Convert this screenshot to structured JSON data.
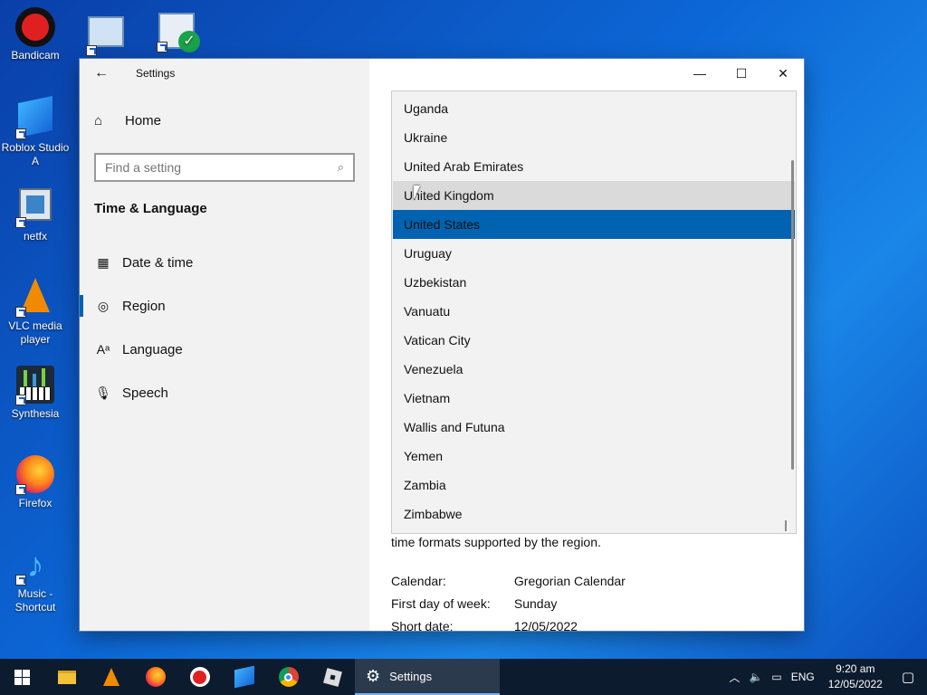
{
  "desktop": {
    "icons": [
      {
        "label": "Bandicam"
      },
      {
        "label": "Roblox Studio A"
      },
      {
        "label": "netfx"
      },
      {
        "label": "VLC media player"
      },
      {
        "label": "Synthesia"
      },
      {
        "label": "Firefox"
      },
      {
        "label": "Music - Shortcut"
      }
    ]
  },
  "window": {
    "title": "Settings",
    "controls": {
      "minimize": "—",
      "maximize": "☐",
      "close": "✕"
    }
  },
  "sidebar": {
    "home_label": "Home",
    "search_placeholder": "Find a setting",
    "section_title": "Time & Language",
    "items": [
      {
        "label": "Date & time",
        "icon": "calendar-clock-icon"
      },
      {
        "label": "Region",
        "icon": "globe-icon"
      },
      {
        "label": "Language",
        "icon": "language-icon"
      },
      {
        "label": "Speech",
        "icon": "microphone-icon"
      }
    ]
  },
  "dropdown": {
    "options": [
      "Uganda",
      "Ukraine",
      "United Arab Emirates",
      "United Kingdom",
      "United States",
      "Uruguay",
      "Uzbekistan",
      "Vanuatu",
      "Vatican City",
      "Venezuela",
      "Vietnam",
      "Wallis and Futuna",
      "Yemen",
      "Zambia",
      "Zimbabwe"
    ],
    "hovered": "United Kingdom",
    "selected": "United States"
  },
  "content": {
    "description_tail": "time formats supported by the region.",
    "details": [
      {
        "key": "Calendar:",
        "value": "Gregorian Calendar"
      },
      {
        "key": "First day of week:",
        "value": "Sunday"
      },
      {
        "key": "Short date:",
        "value": "12/05/2022"
      }
    ]
  },
  "taskbar": {
    "settings_label": "Settings",
    "language": "ENG",
    "time": "9:20 am",
    "date": "12/05/2022"
  },
  "colors": {
    "accent": "#0063b1",
    "sidebar_bg": "#f2f2f2",
    "taskbar_bg": "#0d1b2e"
  }
}
